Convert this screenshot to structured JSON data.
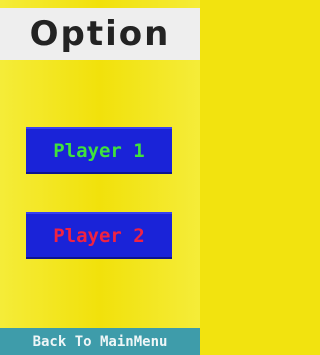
{
  "header": {
    "title": "Option"
  },
  "menu": {
    "player1_label": "Player 1",
    "player2_label": "Player 2"
  },
  "footer": {
    "back_label": "Back To MainMenu"
  },
  "colors": {
    "background": "#f2e30f",
    "header_bg": "#eeeeee",
    "title_text": "#232323",
    "button_bg": "#1a23d8",
    "player1_text": "#3fe23b",
    "player2_text": "#f02242",
    "footer_bg": "#3e9caa",
    "footer_text": "#eef6f7"
  }
}
